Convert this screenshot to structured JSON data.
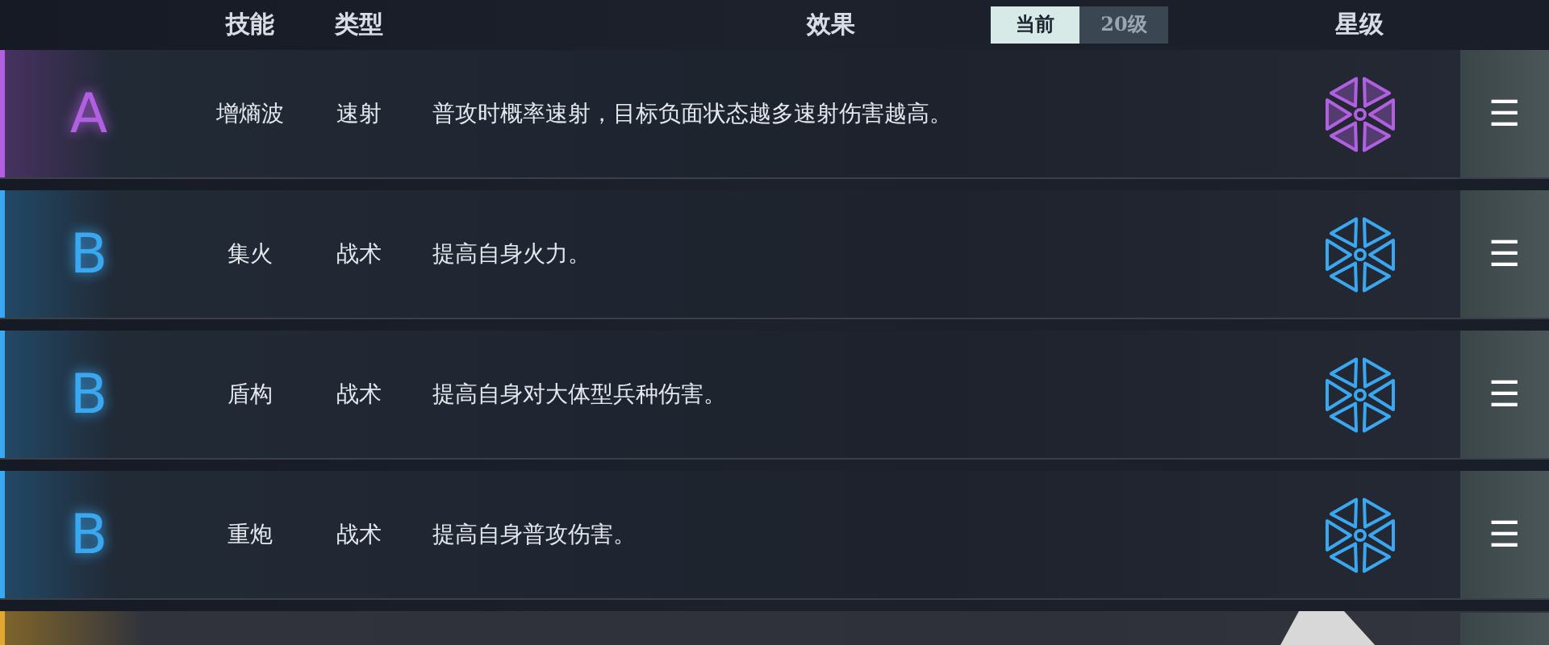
{
  "header": {
    "skill": "技能",
    "type": "类型",
    "effect": "效果",
    "toggle": [
      {
        "label": "当前",
        "selected": true
      },
      {
        "label": "20级",
        "selected": false
      }
    ],
    "stars": "星级"
  },
  "skills": [
    {
      "grade": "A",
      "color": "#b060e0",
      "name": "增熵波",
      "type": "速射",
      "effect": "普攻时概率速射，目标负面状态越多速射伤害越高。",
      "menu": "☰"
    },
    {
      "grade": "B",
      "color": "#3aa8f0",
      "name": "集火",
      "type": "战术",
      "effect": "提高自身火力。",
      "menu": "☰"
    },
    {
      "grade": "B",
      "color": "#3aa8f0",
      "name": "盾构",
      "type": "战术",
      "effect": "提高自身对大体型兵种伤害。",
      "menu": "☰"
    },
    {
      "grade": "B",
      "color": "#3aa8f0",
      "name": "重炮",
      "type": "战术",
      "effect": "提高自身普攻伤害。",
      "menu": "☰"
    }
  ],
  "partial_row": {
    "color": "#e0a830"
  }
}
